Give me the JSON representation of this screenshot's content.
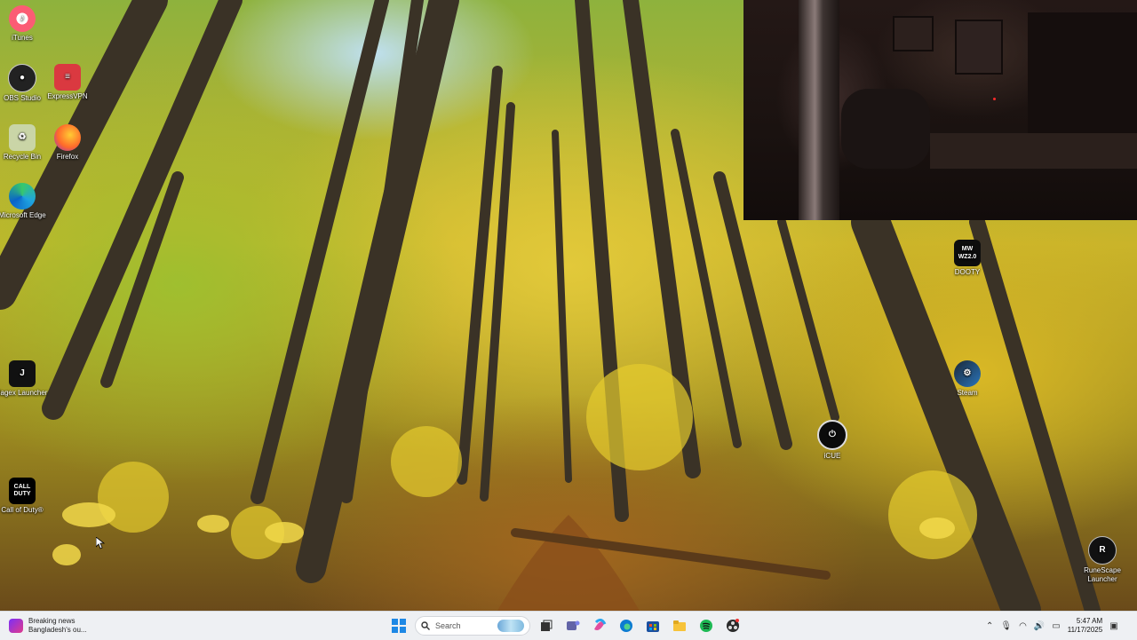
{
  "desktop": {
    "icons": [
      {
        "label": "iTunes",
        "icon": "itunes-icon"
      },
      {
        "label": "OBS Studio",
        "icon": "obs-icon"
      },
      {
        "label": "ExpressVPN",
        "icon": "expressvpn-icon"
      },
      {
        "label": "Recycle Bin",
        "icon": "recycle-bin-icon"
      },
      {
        "label": "Firefox",
        "icon": "firefox-icon"
      },
      {
        "label": "Microsoft Edge",
        "icon": "edge-icon"
      },
      {
        "label": "Jagex Launcher",
        "icon": "jagex-icon"
      },
      {
        "label": "Call of Duty®",
        "icon": "call-of-duty-icon"
      },
      {
        "label": "DOOTY",
        "icon": "mw-wz2-icon"
      },
      {
        "label": "Steam",
        "icon": "steam-icon"
      },
      {
        "label": "iCUE",
        "icon": "icue-icon"
      },
      {
        "label": "RuneScape Launcher",
        "icon": "runescape-icon"
      }
    ],
    "icon_text": {
      "cod_line1": "CALL",
      "cod_line2": "DUTY",
      "mw_line1": "MW",
      "mw_line2": "WZ2.0",
      "jagex": "J",
      "runescape": "R"
    }
  },
  "taskbar": {
    "news_title": "Breaking news",
    "news_sub": "Bangladesh's ou...",
    "search_placeholder": "Search",
    "time": "5:47 AM",
    "date": "11/17/2025",
    "apps": [
      "windows-start-icon",
      "search-icon",
      "task-view-icon",
      "teams-icon",
      "copilot-icon",
      "edge-icon",
      "store-icon",
      "file-explorer-icon",
      "spotify-icon",
      "obs-icon"
    ]
  },
  "colors": {
    "taskbar_bg": "#eef0f3",
    "accent": "#0a64c8"
  }
}
